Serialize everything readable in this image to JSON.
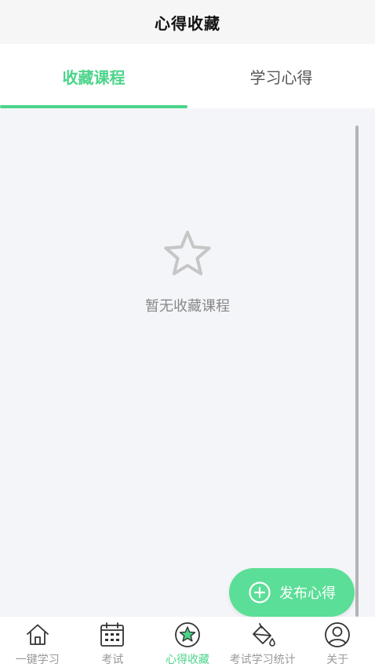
{
  "header": {
    "title": "心得收藏"
  },
  "tabs": [
    {
      "label": "收藏课程",
      "active": true
    },
    {
      "label": "学习心得",
      "active": false
    }
  ],
  "empty_state": {
    "icon": "star-outline-icon",
    "text": "暂无收藏课程"
  },
  "fab": {
    "icon": "plus-circle-icon",
    "label": "发布心得"
  },
  "bottom_nav": [
    {
      "label": "一键学习",
      "icon": "home-icon",
      "active": false
    },
    {
      "label": "考试",
      "icon": "calendar-icon",
      "active": false
    },
    {
      "label": "心得收藏",
      "icon": "star-circle-icon",
      "active": true
    },
    {
      "label": "考试学习统计",
      "icon": "paint-bucket-icon",
      "active": false
    },
    {
      "label": "关于",
      "icon": "user-circle-icon",
      "active": false
    }
  ],
  "colors": {
    "accent": "#4cd48a",
    "fab": "#5bde97",
    "inactive": "#999999",
    "background": "#f4f5f9"
  }
}
